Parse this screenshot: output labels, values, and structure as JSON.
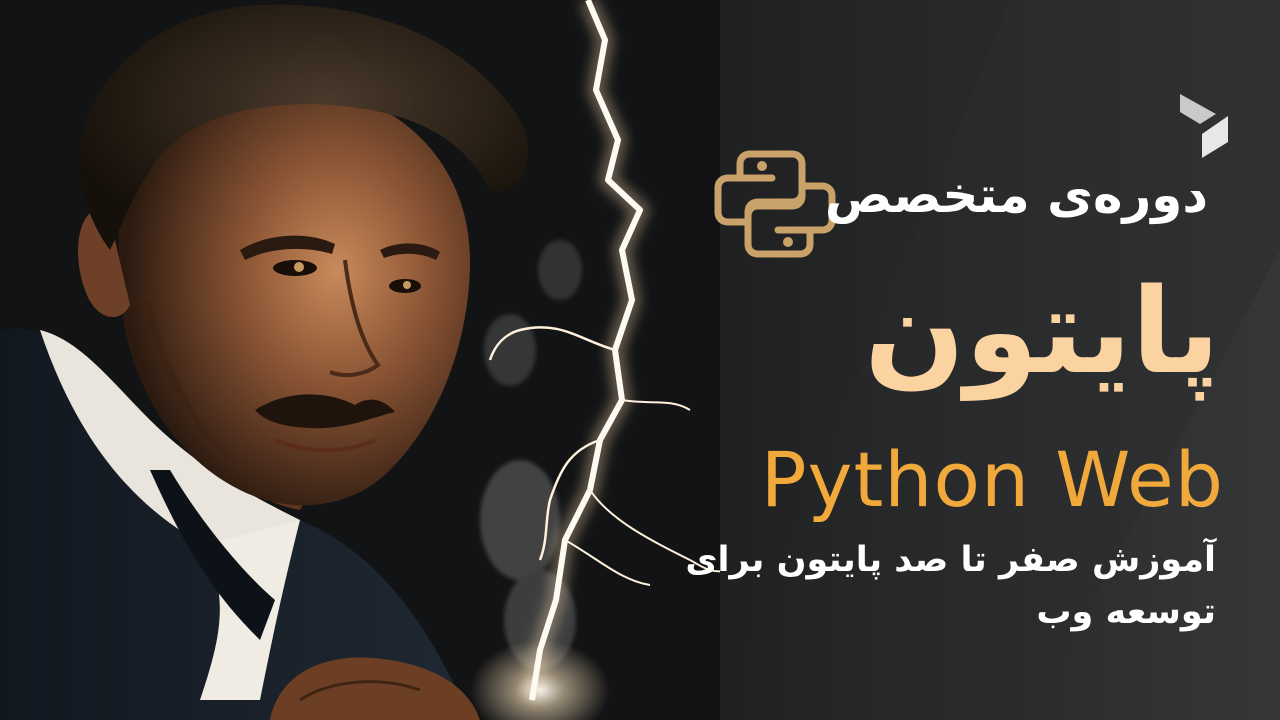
{
  "hero": {
    "course_prefix": "دوره‌ی متخصص",
    "course_name": "پایتون",
    "course_subtitle": "Python Web",
    "description": "آموزش صفر تا صد پایتون برای توسعه وب"
  },
  "icons": {
    "brand": "brand-logo-icon",
    "python": "python-logo-icon"
  },
  "colors": {
    "background": "#1b1b1c",
    "heading_cream": "#fbd3a1",
    "subtitle_orange": "#f2a93c",
    "python_logo_gold": "#c9a26a",
    "text_white": "#ffffff",
    "lightning": "#fff6e8"
  }
}
